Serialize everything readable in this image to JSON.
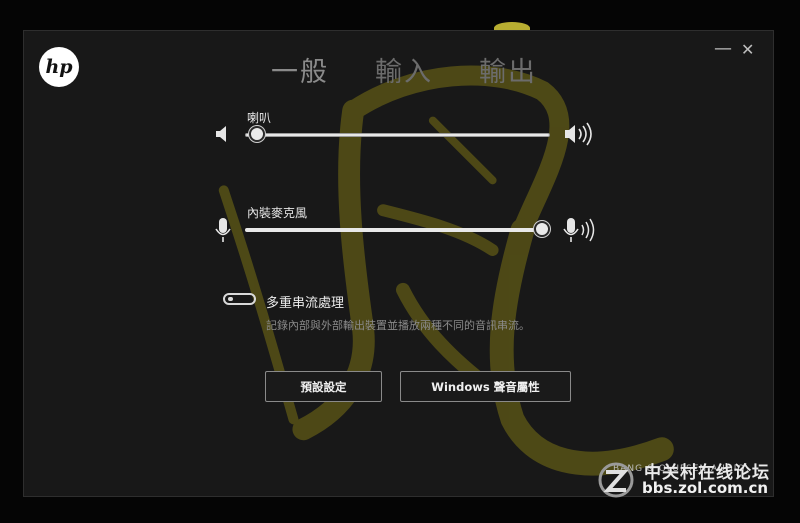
{
  "app": {
    "logo_text": "hp"
  },
  "tabs": [
    {
      "label": "一般",
      "active": true
    },
    {
      "label": "輸入",
      "active": false
    },
    {
      "label": "輸出",
      "active": false
    }
  ],
  "window_controls": {
    "minimize": "—",
    "close": "✕"
  },
  "speaker": {
    "label": "喇叭",
    "level": 0.04
  },
  "microphone": {
    "label": "內裝麥克風",
    "level": 1.0
  },
  "multistream": {
    "title": "多重串流處理",
    "description": "記錄內部與外部輸出裝置並播放兩種不同的音訊串流。",
    "enabled": false
  },
  "buttons": {
    "defaults": "預設設定",
    "windows_sound": "Windows 聲音屬性"
  },
  "brand_text": "BANG & OLUFSEN AUDIO",
  "watermark_site": {
    "title": "中关村在线论坛",
    "url": "bbs.zol.com.cn"
  },
  "colors": {
    "background": "#181818",
    "watermark": "#6b6418",
    "accent": "#e8e8e8"
  },
  "icons": [
    "hp-logo-icon",
    "speaker-low-icon",
    "speaker-high-icon",
    "mic-icon",
    "mic-high-icon",
    "toggle-icon"
  ]
}
